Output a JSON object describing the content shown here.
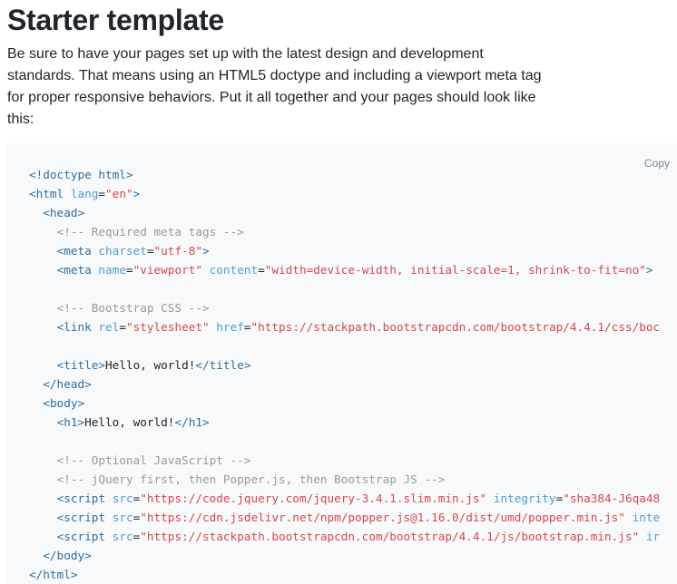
{
  "heading": "Starter template",
  "intro": "Be sure to have your pages set up with the latest design and development standards. That means using an HTML5 doctype and including a viewport meta tag for proper responsive behaviors. Put it all together and your pages should look like this:",
  "copy_label": "Copy",
  "code_lines": [
    {
      "indent": "",
      "tokens": [
        [
          "doctype",
          "<!doctype html>"
        ]
      ]
    },
    {
      "indent": "",
      "tokens": [
        [
          "tag",
          "<html"
        ],
        [
          "text",
          " "
        ],
        [
          "attr",
          "lang"
        ],
        [
          "text",
          "="
        ],
        [
          "val",
          "\"en\""
        ],
        [
          "tag",
          ">"
        ]
      ]
    },
    {
      "indent": "  ",
      "tokens": [
        [
          "tag",
          "<head>"
        ]
      ]
    },
    {
      "indent": "    ",
      "tokens": [
        [
          "comment",
          "<!-- Required meta tags -->"
        ]
      ]
    },
    {
      "indent": "    ",
      "tokens": [
        [
          "tag",
          "<meta"
        ],
        [
          "text",
          " "
        ],
        [
          "attr",
          "charset"
        ],
        [
          "text",
          "="
        ],
        [
          "val",
          "\"utf-8\""
        ],
        [
          "tag",
          ">"
        ]
      ]
    },
    {
      "indent": "    ",
      "tokens": [
        [
          "tag",
          "<meta"
        ],
        [
          "text",
          " "
        ],
        [
          "attr",
          "name"
        ],
        [
          "text",
          "="
        ],
        [
          "val",
          "\"viewport\""
        ],
        [
          "text",
          " "
        ],
        [
          "attr",
          "content"
        ],
        [
          "text",
          "="
        ],
        [
          "val",
          "\"width=device-width, initial-scale=1, shrink-to-fit=no\""
        ],
        [
          "tag",
          ">"
        ]
      ]
    },
    {
      "indent": "",
      "tokens": []
    },
    {
      "indent": "    ",
      "tokens": [
        [
          "comment",
          "<!-- Bootstrap CSS -->"
        ]
      ]
    },
    {
      "indent": "    ",
      "tokens": [
        [
          "tag",
          "<link"
        ],
        [
          "text",
          " "
        ],
        [
          "attr",
          "rel"
        ],
        [
          "text",
          "="
        ],
        [
          "val",
          "\"stylesheet\""
        ],
        [
          "text",
          " "
        ],
        [
          "attr",
          "href"
        ],
        [
          "text",
          "="
        ],
        [
          "val",
          "\"https://stackpath.bootstrapcdn.com/bootstrap/4.4.1/css/boc"
        ]
      ]
    },
    {
      "indent": "",
      "tokens": []
    },
    {
      "indent": "    ",
      "tokens": [
        [
          "tag",
          "<title>"
        ],
        [
          "text",
          "Hello, world!"
        ],
        [
          "tag",
          "</title>"
        ]
      ]
    },
    {
      "indent": "  ",
      "tokens": [
        [
          "tag",
          "</head>"
        ]
      ]
    },
    {
      "indent": "  ",
      "tokens": [
        [
          "tag",
          "<body>"
        ]
      ]
    },
    {
      "indent": "    ",
      "tokens": [
        [
          "tag",
          "<h1>"
        ],
        [
          "text",
          "Hello, world!"
        ],
        [
          "tag",
          "</h1>"
        ]
      ]
    },
    {
      "indent": "",
      "tokens": []
    },
    {
      "indent": "    ",
      "tokens": [
        [
          "comment",
          "<!-- Optional JavaScript -->"
        ]
      ]
    },
    {
      "indent": "    ",
      "tokens": [
        [
          "comment",
          "<!-- jQuery first, then Popper.js, then Bootstrap JS -->"
        ]
      ]
    },
    {
      "indent": "    ",
      "tokens": [
        [
          "tag",
          "<script"
        ],
        [
          "text",
          " "
        ],
        [
          "attr",
          "src"
        ],
        [
          "text",
          "="
        ],
        [
          "val",
          "\"https://code.jquery.com/jquery-3.4.1.slim.min.js\""
        ],
        [
          "text",
          " "
        ],
        [
          "attr",
          "integrity"
        ],
        [
          "text",
          "="
        ],
        [
          "val",
          "\"sha384-J6qa48"
        ]
      ]
    },
    {
      "indent": "    ",
      "tokens": [
        [
          "tag",
          "<script"
        ],
        [
          "text",
          " "
        ],
        [
          "attr",
          "src"
        ],
        [
          "text",
          "="
        ],
        [
          "val",
          "\"https://cdn.jsdelivr.net/npm/popper.js@1.16.0/dist/umd/popper.min.js\""
        ],
        [
          "text",
          " "
        ],
        [
          "attr",
          "inte"
        ]
      ]
    },
    {
      "indent": "    ",
      "tokens": [
        [
          "tag",
          "<script"
        ],
        [
          "text",
          " "
        ],
        [
          "attr",
          "src"
        ],
        [
          "text",
          "="
        ],
        [
          "val",
          "\"https://stackpath.bootstrapcdn.com/bootstrap/4.4.1/js/bootstrap.min.js\""
        ],
        [
          "text",
          " "
        ],
        [
          "attr",
          "ir"
        ]
      ]
    },
    {
      "indent": "  ",
      "tokens": [
        [
          "tag",
          "</body>"
        ]
      ]
    },
    {
      "indent": "",
      "tokens": [
        [
          "tag",
          "</html>"
        ]
      ]
    }
  ]
}
